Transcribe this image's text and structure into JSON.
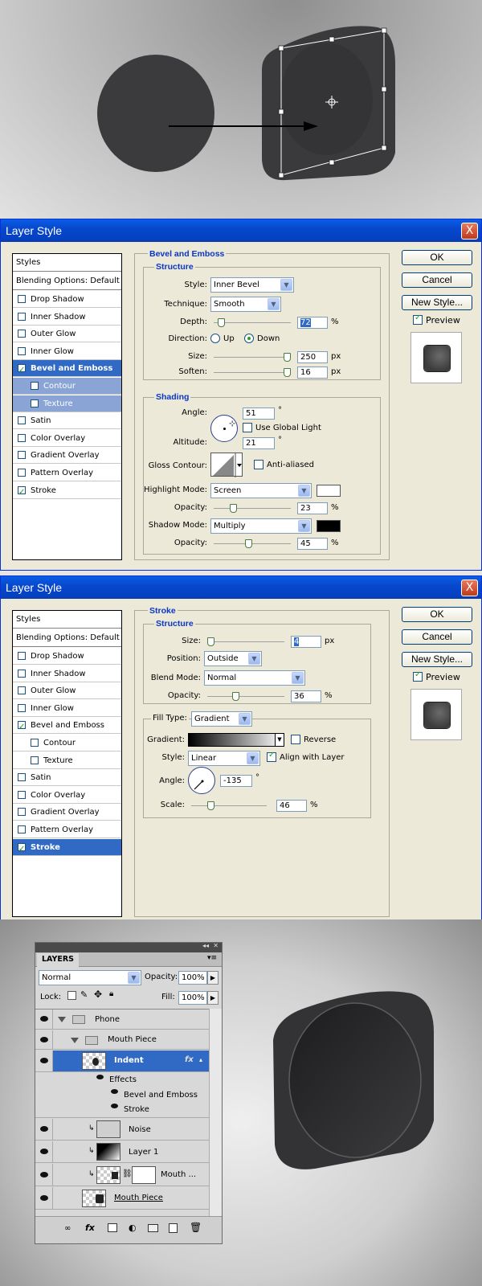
{
  "dialog1": {
    "title": "Layer Style",
    "close": "X",
    "styles_header": "Styles",
    "blending": "Blending Options: Default",
    "items": [
      {
        "label": "Drop Shadow",
        "checked": false
      },
      {
        "label": "Inner Shadow",
        "checked": false
      },
      {
        "label": "Outer Glow",
        "checked": false
      },
      {
        "label": "Inner Glow",
        "checked": false
      },
      {
        "label": "Bevel and Emboss",
        "checked": true
      },
      {
        "label": "Contour",
        "checked": false
      },
      {
        "label": "Texture",
        "checked": false
      },
      {
        "label": "Satin",
        "checked": false
      },
      {
        "label": "Color Overlay",
        "checked": false
      },
      {
        "label": "Gradient Overlay",
        "checked": false
      },
      {
        "label": "Pattern Overlay",
        "checked": false
      },
      {
        "label": "Stroke",
        "checked": true
      }
    ],
    "section_title": "Bevel and Emboss",
    "structure_title": "Structure",
    "style_label": "Style:",
    "style_value": "Inner Bevel",
    "technique_label": "Technique:",
    "technique_value": "Smooth",
    "depth_label": "Depth:",
    "depth_value": "72",
    "depth_unit": "%",
    "depth_pct": 0.06,
    "direction_label": "Direction:",
    "dir_up": "Up",
    "dir_down": "Down",
    "size_label": "Size:",
    "size_value": "250",
    "size_unit": "px",
    "size_pct": 1.0,
    "soften_label": "Soften:",
    "soften_value": "16",
    "soften_unit": "px",
    "soften_pct": 1.0,
    "shading_title": "Shading",
    "angle_label": "Angle:",
    "angle_value": "51",
    "angle_unit": "°",
    "global_light": "Use Global Light",
    "altitude_label": "Altitude:",
    "altitude_value": "21",
    "altitude_unit": "°",
    "gloss_label": "Gloss Contour:",
    "anti_aliased": "Anti-aliased",
    "highlight_label": "Highlight Mode:",
    "highlight_value": "Screen",
    "opacity_label": "Opacity:",
    "h_opacity_value": "23",
    "h_opacity_unit": "%",
    "h_opacity_pct": 0.23,
    "shadow_label": "Shadow Mode:",
    "shadow_value": "Multiply",
    "s_opacity_value": "45",
    "s_opacity_unit": "%",
    "s_opacity_pct": 0.45,
    "highlight_color": "#ffffff",
    "shadow_color": "#000000",
    "ok": "OK",
    "cancel": "Cancel",
    "new_style": "New Style...",
    "preview": "Preview"
  },
  "dialog2": {
    "title": "Layer Style",
    "close": "X",
    "styles_header": "Styles",
    "blending": "Blending Options: Default",
    "items": [
      {
        "label": "Drop Shadow",
        "checked": false
      },
      {
        "label": "Inner Shadow",
        "checked": false
      },
      {
        "label": "Outer Glow",
        "checked": false
      },
      {
        "label": "Inner Glow",
        "checked": false
      },
      {
        "label": "Bevel and Emboss",
        "checked": true
      },
      {
        "label": "Contour",
        "checked": false
      },
      {
        "label": "Texture",
        "checked": false
      },
      {
        "label": "Satin",
        "checked": false
      },
      {
        "label": "Color Overlay",
        "checked": false
      },
      {
        "label": "Gradient Overlay",
        "checked": false
      },
      {
        "label": "Pattern Overlay",
        "checked": false
      },
      {
        "label": "Stroke",
        "checked": true
      }
    ],
    "section_title": "Stroke",
    "structure_title": "Structure",
    "size_label": "Size:",
    "size_value": "4",
    "size_unit": "px",
    "size_pct": 0.0,
    "position_label": "Position:",
    "position_value": "Outside",
    "blend_label": "Blend Mode:",
    "blend_value": "Normal",
    "opacity_label": "Opacity:",
    "opacity_value": "36",
    "opacity_unit": "%",
    "opacity_pct": 0.36,
    "fill_type_label": "Fill Type:",
    "fill_type_value": "Gradient",
    "gradient_label": "Gradient:",
    "reverse": "Reverse",
    "style_label": "Style:",
    "style_value": "Linear",
    "align_layer": "Align with Layer",
    "angle_label": "Angle:",
    "angle_value": "-135",
    "angle_unit": "°",
    "scale_label": "Scale:",
    "scale_value": "46",
    "scale_unit": "%",
    "scale_pct": 0.23,
    "ok": "OK",
    "cancel": "Cancel",
    "new_style": "New Style...",
    "preview": "Preview"
  },
  "layers": {
    "collapse": "◂◂",
    "close": "✕",
    "tab": "LAYERS",
    "blend_mode": "Normal",
    "opacity_label": "Opacity:",
    "opacity_value": "100%",
    "lock_label": "Lock:",
    "fill_label": "Fill:",
    "fill_value": "100%",
    "phone": "Phone",
    "mouth_piece_group": "Mouth Piece",
    "indent": "Indent",
    "fx": "fx",
    "effects": "Effects",
    "bevel": "Bevel and Emboss",
    "stroke": "Stroke",
    "noise": "Noise",
    "layer1": "Layer 1",
    "mouth_masked": "Mouth ...",
    "mouth_piece": "Mouth Piece"
  }
}
